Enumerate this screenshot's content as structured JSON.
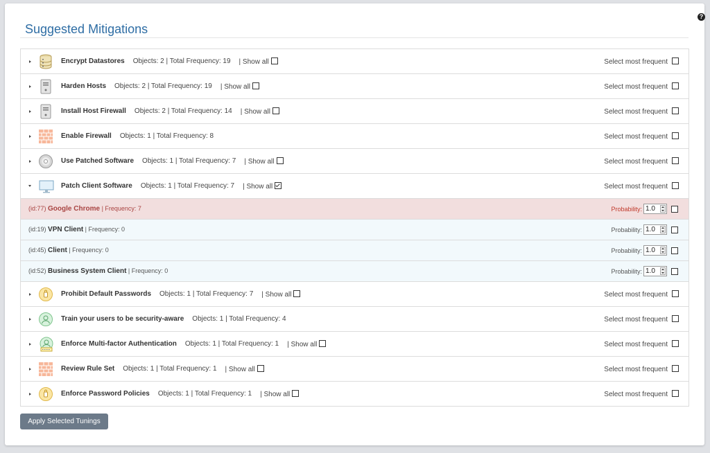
{
  "page": {
    "title": "Suggested Mitigations",
    "help_icon": "question-circle-icon",
    "apply_button": "Apply Selected Tunings"
  },
  "colors": {
    "title": "#2e6da4",
    "highlight_row": "#f2dede",
    "highlight_text": "#a94442",
    "sub_row": "#f2f9fc",
    "button": "#6c7a89"
  },
  "mitigations": [
    {
      "name": "Encrypt Datastores",
      "icon": "database-icon",
      "stats": "Objects: 2 | Total Frequency: 19",
      "show_all": "| Show all",
      "has_show_all": true,
      "show_all_checked": false,
      "expanded": false,
      "select_label": "Select most frequent"
    },
    {
      "name": "Harden Hosts",
      "icon": "server-icon",
      "stats": "Objects: 2 | Total Frequency: 19",
      "show_all": "| Show all",
      "has_show_all": true,
      "show_all_checked": false,
      "expanded": false,
      "select_label": "Select most frequent"
    },
    {
      "name": "Install Host Firewall",
      "icon": "server-icon",
      "stats": "Objects: 2 | Total Frequency: 14",
      "show_all": "| Show all",
      "has_show_all": true,
      "show_all_checked": false,
      "expanded": false,
      "select_label": "Select most frequent"
    },
    {
      "name": "Enable Firewall",
      "icon": "firewall-icon",
      "stats": "Objects: 1 | Total Frequency: 8",
      "show_all": "",
      "has_show_all": false,
      "show_all_checked": false,
      "expanded": false,
      "select_label": "Select most frequent"
    },
    {
      "name": "Use Patched Software",
      "icon": "disc-icon",
      "stats": "Objects: 1 | Total Frequency: 7",
      "show_all": "| Show all",
      "has_show_all": true,
      "show_all_checked": false,
      "expanded": false,
      "select_label": "Select most frequent"
    },
    {
      "name": "Patch Client Software",
      "icon": "monitor-icon",
      "stats": "Objects: 1 | Total Frequency: 7",
      "show_all": "| Show all",
      "has_show_all": true,
      "show_all_checked": true,
      "expanded": true,
      "select_label": "Select most frequent"
    },
    {
      "name": "Prohibit Default Passwords",
      "icon": "lock-icon",
      "stats": "Objects: 1 | Total Frequency: 7",
      "show_all": "| Show all",
      "has_show_all": true,
      "show_all_checked": false,
      "expanded": false,
      "select_label": "Select most frequent"
    },
    {
      "name": "Train your users to be security-aware",
      "icon": "user-icon",
      "stats": "Objects: 1 | Total Frequency: 4",
      "show_all": "",
      "has_show_all": false,
      "show_all_checked": false,
      "expanded": false,
      "select_label": "Select most frequent"
    },
    {
      "name": "Enforce Multi-factor Authentication",
      "icon": "user-keyboard-icon",
      "stats": "Objects: 1 | Total Frequency: 1",
      "show_all": "| Show all",
      "has_show_all": true,
      "show_all_checked": false,
      "expanded": false,
      "select_label": "Select most frequent"
    },
    {
      "name": "Review Rule Set",
      "icon": "firewall-icon",
      "stats": "Objects: 1 | Total Frequency: 1",
      "show_all": "| Show all",
      "has_show_all": true,
      "show_all_checked": false,
      "expanded": false,
      "select_label": "Select most frequent"
    },
    {
      "name": "Enforce Password Policies",
      "icon": "lock-icon",
      "stats": "Objects: 1 | Total Frequency: 1",
      "show_all": "| Show all",
      "has_show_all": true,
      "show_all_checked": false,
      "expanded": false,
      "select_label": "Select most frequent"
    }
  ],
  "expanded_objects": [
    {
      "id": "(id:77)",
      "name": "Google Chrome",
      "frequency": "| Frequency: 7",
      "probability_label": "Probability:",
      "probability": "1.0",
      "highlighted": true
    },
    {
      "id": "(id:19)",
      "name": "VPN Client",
      "frequency": "| Frequency: 0",
      "probability_label": "Probability:",
      "probability": "1.0",
      "highlighted": false
    },
    {
      "id": "(id:45)",
      "name": "Client",
      "frequency": "| Frequency: 0",
      "probability_label": "Probability:",
      "probability": "1.0",
      "highlighted": false
    },
    {
      "id": "(id:52)",
      "name": "Business System Client",
      "frequency": "| Frequency: 0",
      "probability_label": "Probability:",
      "probability": "1.0",
      "highlighted": false
    }
  ]
}
